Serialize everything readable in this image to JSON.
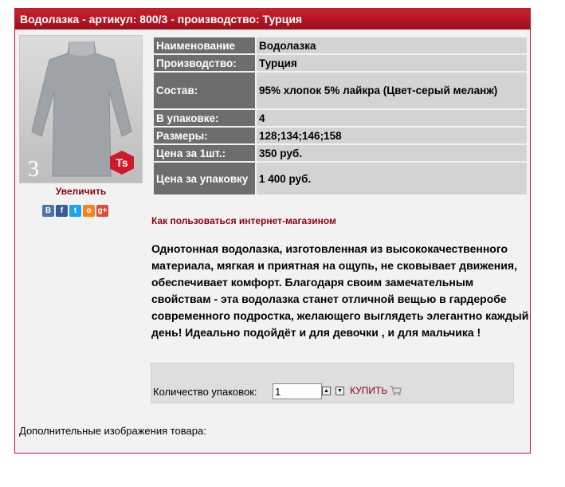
{
  "title": "Водолазка - артикул: 800/3 - производство: Турция",
  "image": {
    "number": "3",
    "logo_text": "Ts"
  },
  "zoom_label": "Увеличить",
  "social": [
    {
      "icon": "vk-icon",
      "glyph": "В",
      "color": "#4a76a8"
    },
    {
      "icon": "facebook-icon",
      "glyph": "f",
      "color": "#3b5998"
    },
    {
      "icon": "twitter-icon",
      "glyph": "t",
      "color": "#1da1f2"
    },
    {
      "icon": "odnoklassniki-icon",
      "glyph": "о",
      "color": "#f58220"
    },
    {
      "icon": "google-plus-icon",
      "glyph": "g+",
      "color": "#dd4b39"
    }
  ],
  "specs": [
    {
      "key": "Наименование",
      "value": "Водолазка"
    },
    {
      "key": "Производство:",
      "value": "Турция"
    },
    {
      "key": "Состав:",
      "value": "95% хлопок 5% лайкра (Цвет-серый меланж)"
    },
    {
      "key": "В упаковке:",
      "value": "4"
    },
    {
      "key": "Размеры:",
      "value": "128;134;146;158"
    },
    {
      "key": "Цена за 1шт.:",
      "value": "350 руб."
    },
    {
      "key": "Цена за упаковку",
      "value": "1 400 руб."
    }
  ],
  "howto_link": "Как пользоваться интернет-магазином",
  "description": "Однотонная водолазка, изготовленная из высококачественного материала, мягкая и приятная на ощупь, не сковывает движения, обеспечивает комфорт. Благодаря своим замечательным свойствам - эта водолазка станет отличной вещью в гардеробе современного подростка, желающего выглядеть элегантно каждый день! Идеально подойдёт и для девочки , и для мальчика !",
  "order": {
    "label": "Количество упаковок:",
    "quantity": "1",
    "buy_label": "КУПИТЬ"
  },
  "extra_images_label": "Дополнительные изображения товара:",
  "colors": {
    "accent": "#b22030",
    "link": "#8b0010"
  }
}
